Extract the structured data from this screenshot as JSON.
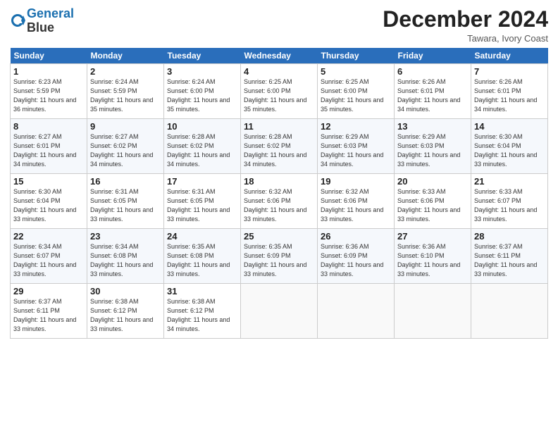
{
  "logo": {
    "line1": "General",
    "line2": "Blue"
  },
  "header": {
    "month": "December 2024",
    "location": "Tawara, Ivory Coast"
  },
  "weekdays": [
    "Sunday",
    "Monday",
    "Tuesday",
    "Wednesday",
    "Thursday",
    "Friday",
    "Saturday"
  ],
  "weeks": [
    [
      {
        "num": "1",
        "rise": "6:23 AM",
        "set": "5:59 PM",
        "daylight": "11 hours and 36 minutes."
      },
      {
        "num": "2",
        "rise": "6:24 AM",
        "set": "5:59 PM",
        "daylight": "11 hours and 35 minutes."
      },
      {
        "num": "3",
        "rise": "6:24 AM",
        "set": "6:00 PM",
        "daylight": "11 hours and 35 minutes."
      },
      {
        "num": "4",
        "rise": "6:25 AM",
        "set": "6:00 PM",
        "daylight": "11 hours and 35 minutes."
      },
      {
        "num": "5",
        "rise": "6:25 AM",
        "set": "6:00 PM",
        "daylight": "11 hours and 35 minutes."
      },
      {
        "num": "6",
        "rise": "6:26 AM",
        "set": "6:01 PM",
        "daylight": "11 hours and 34 minutes."
      },
      {
        "num": "7",
        "rise": "6:26 AM",
        "set": "6:01 PM",
        "daylight": "11 hours and 34 minutes."
      }
    ],
    [
      {
        "num": "8",
        "rise": "6:27 AM",
        "set": "6:01 PM",
        "daylight": "11 hours and 34 minutes."
      },
      {
        "num": "9",
        "rise": "6:27 AM",
        "set": "6:02 PM",
        "daylight": "11 hours and 34 minutes."
      },
      {
        "num": "10",
        "rise": "6:28 AM",
        "set": "6:02 PM",
        "daylight": "11 hours and 34 minutes."
      },
      {
        "num": "11",
        "rise": "6:28 AM",
        "set": "6:02 PM",
        "daylight": "11 hours and 34 minutes."
      },
      {
        "num": "12",
        "rise": "6:29 AM",
        "set": "6:03 PM",
        "daylight": "11 hours and 34 minutes."
      },
      {
        "num": "13",
        "rise": "6:29 AM",
        "set": "6:03 PM",
        "daylight": "11 hours and 33 minutes."
      },
      {
        "num": "14",
        "rise": "6:30 AM",
        "set": "6:04 PM",
        "daylight": "11 hours and 33 minutes."
      }
    ],
    [
      {
        "num": "15",
        "rise": "6:30 AM",
        "set": "6:04 PM",
        "daylight": "11 hours and 33 minutes."
      },
      {
        "num": "16",
        "rise": "6:31 AM",
        "set": "6:05 PM",
        "daylight": "11 hours and 33 minutes."
      },
      {
        "num": "17",
        "rise": "6:31 AM",
        "set": "6:05 PM",
        "daylight": "11 hours and 33 minutes."
      },
      {
        "num": "18",
        "rise": "6:32 AM",
        "set": "6:06 PM",
        "daylight": "11 hours and 33 minutes."
      },
      {
        "num": "19",
        "rise": "6:32 AM",
        "set": "6:06 PM",
        "daylight": "11 hours and 33 minutes."
      },
      {
        "num": "20",
        "rise": "6:33 AM",
        "set": "6:06 PM",
        "daylight": "11 hours and 33 minutes."
      },
      {
        "num": "21",
        "rise": "6:33 AM",
        "set": "6:07 PM",
        "daylight": "11 hours and 33 minutes."
      }
    ],
    [
      {
        "num": "22",
        "rise": "6:34 AM",
        "set": "6:07 PM",
        "daylight": "11 hours and 33 minutes."
      },
      {
        "num": "23",
        "rise": "6:34 AM",
        "set": "6:08 PM",
        "daylight": "11 hours and 33 minutes."
      },
      {
        "num": "24",
        "rise": "6:35 AM",
        "set": "6:08 PM",
        "daylight": "11 hours and 33 minutes."
      },
      {
        "num": "25",
        "rise": "6:35 AM",
        "set": "6:09 PM",
        "daylight": "11 hours and 33 minutes."
      },
      {
        "num": "26",
        "rise": "6:36 AM",
        "set": "6:09 PM",
        "daylight": "11 hours and 33 minutes."
      },
      {
        "num": "27",
        "rise": "6:36 AM",
        "set": "6:10 PM",
        "daylight": "11 hours and 33 minutes."
      },
      {
        "num": "28",
        "rise": "6:37 AM",
        "set": "6:11 PM",
        "daylight": "11 hours and 33 minutes."
      }
    ],
    [
      {
        "num": "29",
        "rise": "6:37 AM",
        "set": "6:11 PM",
        "daylight": "11 hours and 33 minutes."
      },
      {
        "num": "30",
        "rise": "6:38 AM",
        "set": "6:12 PM",
        "daylight": "11 hours and 33 minutes."
      },
      {
        "num": "31",
        "rise": "6:38 AM",
        "set": "6:12 PM",
        "daylight": "11 hours and 34 minutes."
      },
      null,
      null,
      null,
      null
    ]
  ]
}
